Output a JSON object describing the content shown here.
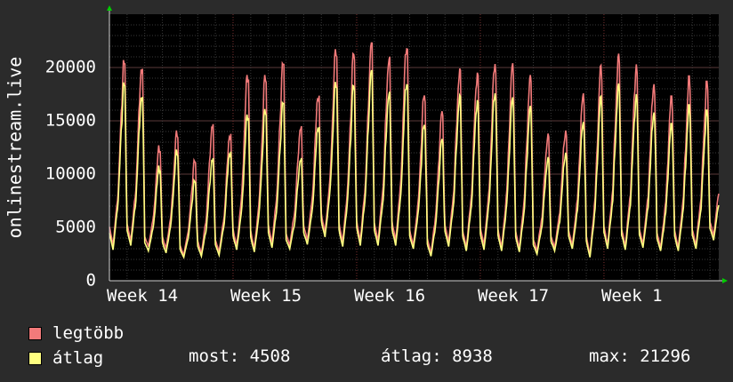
{
  "chart_data": {
    "type": "line",
    "ylabel": "onlinestream.live",
    "ylim": [
      0,
      25000
    ],
    "yticks": [
      0,
      5000,
      10000,
      15000,
      20000
    ],
    "ytick_labels": [
      "0",
      "5000",
      "10000",
      "15000",
      "20000"
    ],
    "x_start_day": 0,
    "x_end_day": 34.5,
    "xtick_labels": [
      "Week 14",
      "Week 15",
      "Week 16",
      "Week 17",
      "Week 1"
    ],
    "xtick_days": [
      0,
      7,
      14,
      21,
      28
    ],
    "grid": true,
    "series": [
      {
        "name": "legtöbb",
        "color": "#f27a7a",
        "daily_peaks": [
          20700,
          20300,
          12700,
          14100,
          11300,
          14700,
          14000,
          19700,
          19300,
          20400,
          14500,
          17700,
          21900,
          21300,
          22300,
          21100,
          22500,
          17600,
          15900,
          19900,
          19700,
          20700,
          20400,
          19300,
          13800,
          14200,
          17700,
          20200,
          21300,
          20300,
          18700,
          17400,
          19200,
          18700,
          18200
        ],
        "daily_lows": [
          3300,
          3700,
          3200,
          3000,
          2400,
          2500,
          2700,
          3200,
          3000,
          3500,
          3300,
          3800,
          4500,
          3600,
          3700,
          3700,
          3700,
          3300,
          2600,
          3600,
          3100,
          3300,
          3100,
          3000,
          2800,
          3100,
          3300,
          2400,
          3300,
          3200,
          3400,
          3100,
          3100,
          3300,
          4200
        ]
      },
      {
        "name": "átlag",
        "color": "#ffff80",
        "daily_peaks": [
          18600,
          17600,
          10800,
          12300,
          9400,
          11500,
          12300,
          15900,
          16100,
          16700,
          11500,
          14700,
          18800,
          18300,
          19700,
          17800,
          19000,
          14800,
          13300,
          17400,
          17100,
          17900,
          17200,
          16400,
          11600,
          12100,
          15000,
          17300,
          18500,
          17500,
          16000,
          14800,
          16500,
          16000,
          15400
        ],
        "daily_lows": [
          2900,
          3300,
          2800,
          2600,
          2200,
          2300,
          2400,
          2900,
          2700,
          3100,
          3000,
          3400,
          4100,
          3200,
          3300,
          3300,
          3300,
          3000,
          2300,
          3200,
          2800,
          2900,
          2800,
          2700,
          2500,
          2800,
          3000,
          2200,
          3000,
          2900,
          3100,
          2800,
          2800,
          3000,
          3800
        ]
      }
    ]
  },
  "legend": {
    "max_label": "legtöbb",
    "avg_label": "átlag",
    "max_color": "#f27a7a",
    "avg_color": "#ffff80"
  },
  "stats": {
    "now": "most: 4508",
    "avg": "átlag: 8938",
    "max": "max: 21296"
  }
}
